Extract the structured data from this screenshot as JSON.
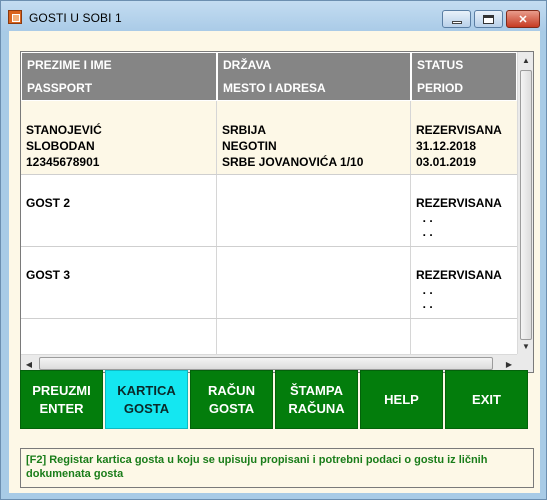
{
  "window": {
    "title": "GOSTI U SOBI 1",
    "minimize_label": "",
    "maximize_label": "",
    "close_label": "✕"
  },
  "grid": {
    "columns": [
      {
        "line1": "PREZIME I IME",
        "line2": "PASSPORT"
      },
      {
        "line1": "DRŽAVA",
        "line2": "MESTO I ADRESA"
      },
      {
        "line1": "STATUS",
        "line2": "PERIOD"
      }
    ],
    "rows": [
      {
        "col1": [
          "STANOJEVIĆ",
          "SLOBODAN",
          "12345678901"
        ],
        "col2": [
          "SRBIJA",
          "NEGOTIN",
          "SRBE JOVANOVIĆA 1/10"
        ],
        "col3": [
          "REZERVISANA",
          "31.12.2018",
          "03.01.2019"
        ]
      },
      {
        "col1": [
          "GOST 2",
          "",
          ""
        ],
        "col2": [
          "",
          "",
          ""
        ],
        "col3": [
          "REZERVISANA",
          "  . .",
          "  . ."
        ]
      },
      {
        "col1": [
          "GOST 3",
          "",
          ""
        ],
        "col2": [
          "",
          "",
          ""
        ],
        "col3": [
          "REZERVISANA",
          "  . .",
          "  . ."
        ]
      }
    ]
  },
  "buttons": [
    {
      "label": "PREUZMI\nENTER",
      "active": false
    },
    {
      "label": "KARTICA\nGOSTA",
      "active": true
    },
    {
      "label": "RAČUN\nGOSTA",
      "active": false
    },
    {
      "label": "ŠTAMPA\nRAČUNA",
      "active": false
    },
    {
      "label": "HELP",
      "active": false
    },
    {
      "label": "EXIT",
      "active": false
    }
  ],
  "status": {
    "text": "[F2] Registar kartica gosta u koju se upisuju propisani i potrebni podaci o gostu iz ličnih dokumenata gosta"
  },
  "colors": {
    "button_green": "#037d0c",
    "button_active": "#14e7f1",
    "header_gray": "#858585",
    "status_text": "#1a7d1a"
  }
}
